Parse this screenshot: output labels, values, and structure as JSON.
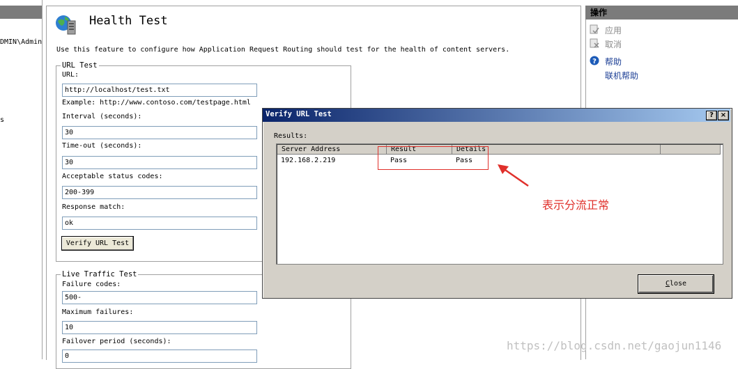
{
  "left_tree": {
    "node_1": "DMIN\\Admin",
    "node_2": "s"
  },
  "feature": {
    "title": "Health Test",
    "description": "Use this feature to configure how Application Request Routing should test for the health of content servers.",
    "icon": "globe-server-icon"
  },
  "url_test": {
    "legend": "URL Test",
    "url_label": "URL:",
    "url_value": "http://localhost/test.txt",
    "example": "Example: http://www.contoso.com/testpage.html",
    "interval_label": "Interval (seconds):",
    "interval_value": "30",
    "timeout_label": "Time-out (seconds):",
    "timeout_value": "30",
    "status_label": "Acceptable status codes:",
    "status_value": "200-399",
    "response_label": "Response match:",
    "response_value": "ok",
    "verify_button": "Verify URL Test"
  },
  "live_traffic": {
    "legend": "Live Traffic Test",
    "failure_codes_label": "Failure codes:",
    "failure_codes_value": "500-",
    "max_failures_label": "Maximum failures:",
    "max_failures_value": "10",
    "failover_label": "Failover period (seconds):",
    "failover_value": "0"
  },
  "actions": {
    "header": "操作",
    "apply": "应用",
    "cancel": "取消",
    "help": "帮助",
    "online_help": "联机帮助"
  },
  "dialog": {
    "title": "Verify URL Test",
    "help_btn": "?",
    "close_btn": "×",
    "results_label": "Results:",
    "columns": [
      "Server Address",
      "Result",
      "Details"
    ],
    "rows": [
      {
        "server": "192.168.2.219",
        "result": "Pass",
        "details": "Pass"
      }
    ],
    "close_button_rest": "lose",
    "close_button_accel": "C"
  },
  "annotation": {
    "text": "表示分流正常",
    "color": "#e0302b"
  },
  "watermark": "https://blog.csdn.net/gaojun1146"
}
